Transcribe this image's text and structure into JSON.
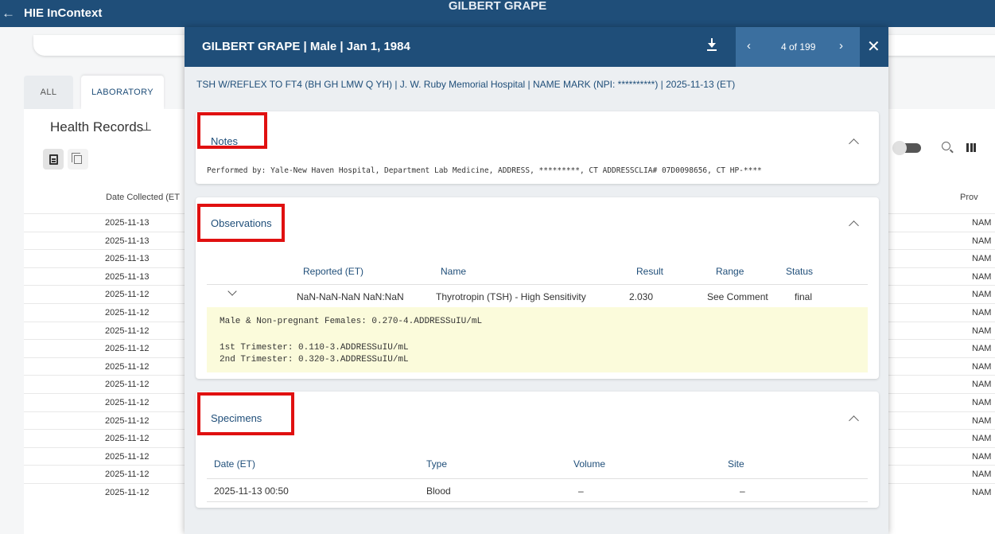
{
  "appbar": {
    "back_glyph": "←",
    "app_title": "HIE InContext",
    "center_title": "GILBERT GRAPE"
  },
  "background": {
    "tabs": [
      "ALL",
      "LABORATORY"
    ],
    "section_title": "Health Records",
    "date_column_header": "Date Collected (ET",
    "provider_column_header": "Prov",
    "rows": [
      {
        "date": "2025-11-13",
        "provider": "NAM"
      },
      {
        "date": "2025-11-13",
        "provider": "NAM"
      },
      {
        "date": "2025-11-13",
        "provider": "NAM"
      },
      {
        "date": "2025-11-13",
        "provider": "NAM"
      },
      {
        "date": "2025-11-12",
        "provider": "NAM"
      },
      {
        "date": "2025-11-12",
        "provider": "NAM"
      },
      {
        "date": "2025-11-12",
        "provider": "NAM"
      },
      {
        "date": "2025-11-12",
        "provider": "NAM"
      },
      {
        "date": "2025-11-12",
        "provider": "NAM"
      },
      {
        "date": "2025-11-12",
        "provider": "NAM"
      },
      {
        "date": "2025-11-12",
        "provider": "NAM"
      },
      {
        "date": "2025-11-12",
        "provider": "NAM"
      },
      {
        "date": "2025-11-12",
        "provider": "NAM"
      },
      {
        "date": "2025-11-12",
        "provider": "NAM"
      },
      {
        "date": "2025-11-12",
        "provider": "NAM"
      },
      {
        "date": "2025-11-12",
        "provider": "NAM"
      }
    ]
  },
  "modal": {
    "title": "GILBERT GRAPE | Male | Jan 1, 1984",
    "pager": {
      "prev": "‹",
      "count": "4 of 199",
      "next": "›"
    },
    "close": "✕",
    "subtitle": "TSH W/REFLEX TO FT4 (BH GH LMW Q YH)  |  J. W. Ruby Memorial Hospital  |  NAME MARK (NPI: **********)  |  2025-11-13 (ET)",
    "notes": {
      "title": "Notes",
      "text": "Performed by: Yale-New Haven Hospital, Department Lab Medicine, ADDRESS, *********, CT ADDRESSCLIA# 07D0098656, CT HP-****"
    },
    "observations": {
      "title": "Observations",
      "headers": {
        "reported": "Reported (ET)",
        "name": "Name",
        "result": "Result",
        "range": "Range",
        "status": "Status"
      },
      "row": {
        "reported": "NaN-NaN-NaN NaN:NaN",
        "name": "Thyrotropin (TSH) - High Sensitivity",
        "result": "2.030",
        "range": "See Comment",
        "status": "final"
      },
      "comment_lines": [
        "Male & Non-pregnant Females: 0.270-4.ADDRESSuIU/mL",
        "1st Trimester: 0.110-3.ADDRESSuIU/mL",
        "2nd Trimester: 0.320-3.ADDRESSuIU/mL"
      ]
    },
    "specimens": {
      "title": "Specimens",
      "headers": {
        "date": "Date (ET)",
        "type": "Type",
        "volume": "Volume",
        "site": "Site"
      },
      "row": {
        "date": "2025-11-13 00:50",
        "type": "Blood",
        "volume": "–",
        "site": "–"
      }
    }
  },
  "colors": {
    "header": "#1f4e79",
    "pager": "#3b6f9f",
    "highlight": "#e01010",
    "comment_bg": "#fbfbdb"
  }
}
